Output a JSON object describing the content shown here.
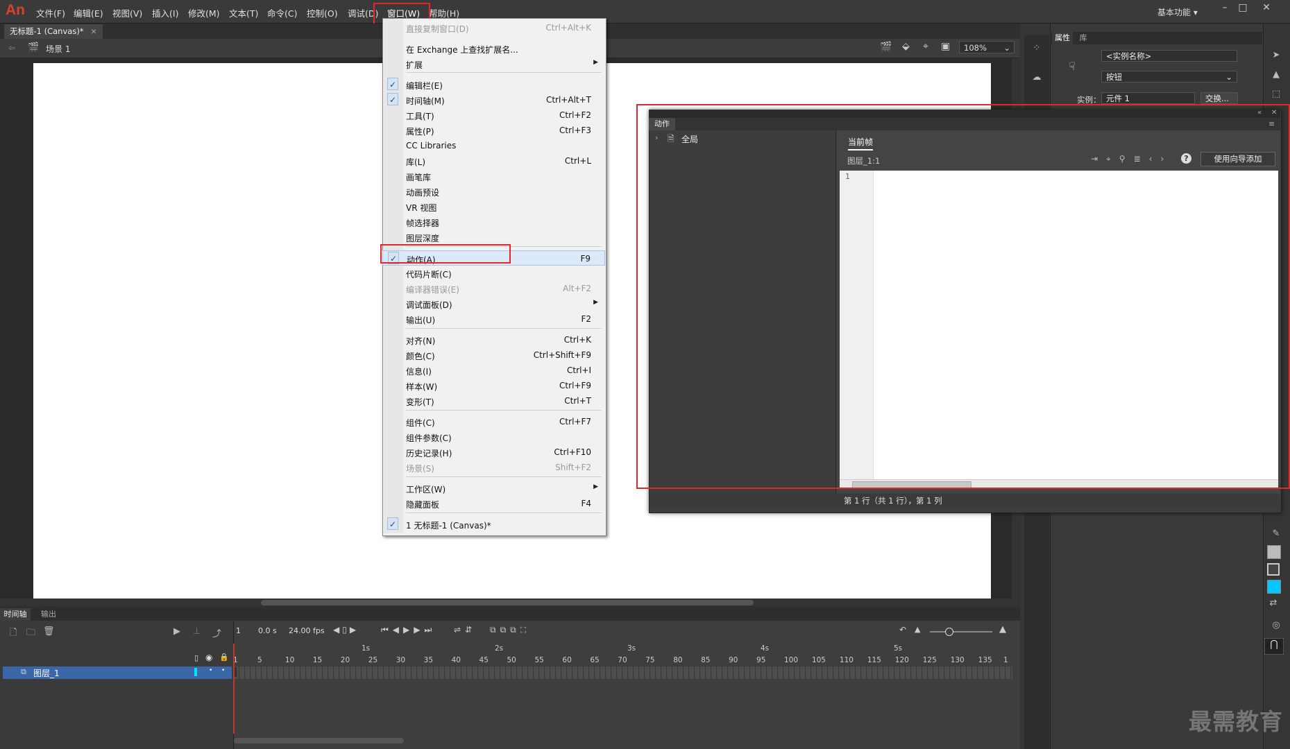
{
  "app": {
    "logo": "An",
    "workspace": "基本功能"
  },
  "menubar": {
    "items": [
      "文件(F)",
      "编辑(E)",
      "视图(V)",
      "插入(I)",
      "修改(M)",
      "文本(T)",
      "命令(C)",
      "控制(O)",
      "调试(D)",
      "窗口(W)",
      "帮助(H)"
    ]
  },
  "document": {
    "tab_title": "无标题-1 (Canvas)*",
    "scene": "场景 1",
    "zoom": "108%"
  },
  "window_menu": {
    "items": [
      {
        "label": "直接复制窗口(D)",
        "shortcut": "Ctrl+Alt+K",
        "disabled": true
      },
      {
        "label": "在 Exchange 上查找扩展名...",
        "shortcut": ""
      },
      {
        "label": "扩展",
        "shortcut": "",
        "submenu": true
      },
      {
        "label": "编辑栏(E)",
        "shortcut": "",
        "checked": true
      },
      {
        "label": "时间轴(M)",
        "shortcut": "Ctrl+Alt+T",
        "checked": true
      },
      {
        "label": "工具(T)",
        "shortcut": "Ctrl+F2"
      },
      {
        "label": "属性(P)",
        "shortcut": "Ctrl+F3"
      },
      {
        "label": "CC Libraries",
        "shortcut": ""
      },
      {
        "label": "库(L)",
        "shortcut": "Ctrl+L"
      },
      {
        "label": "画笔库",
        "shortcut": ""
      },
      {
        "label": "动画预设",
        "shortcut": ""
      },
      {
        "label": "VR 视图",
        "shortcut": ""
      },
      {
        "label": "帧选择器",
        "shortcut": ""
      },
      {
        "label": "图层深度",
        "shortcut": ""
      },
      {
        "label": "动作(A)",
        "shortcut": "F9",
        "checked": true
      },
      {
        "label": "代码片断(C)",
        "shortcut": ""
      },
      {
        "label": "编译器错误(E)",
        "shortcut": "Alt+F2",
        "disabled": true
      },
      {
        "label": "调试面板(D)",
        "shortcut": "",
        "submenu": true
      },
      {
        "label": "输出(U)",
        "shortcut": "F2"
      },
      {
        "label": "对齐(N)",
        "shortcut": "Ctrl+K"
      },
      {
        "label": "颜色(C)",
        "shortcut": "Ctrl+Shift+F9"
      },
      {
        "label": "信息(I)",
        "shortcut": "Ctrl+I"
      },
      {
        "label": "样本(W)",
        "shortcut": "Ctrl+F9"
      },
      {
        "label": "变形(T)",
        "shortcut": "Ctrl+T"
      },
      {
        "label": "组件(C)",
        "shortcut": "Ctrl+F7"
      },
      {
        "label": "组件参数(C)",
        "shortcut": ""
      },
      {
        "label": "历史记录(H)",
        "shortcut": "Ctrl+F10"
      },
      {
        "label": "场景(S)",
        "shortcut": "Shift+F2",
        "disabled": true
      },
      {
        "label": "工作区(W)",
        "shortcut": "",
        "submenu": true
      },
      {
        "label": "隐藏面板",
        "shortcut": "F4"
      },
      {
        "label": "1 无标题-1 (Canvas)*",
        "shortcut": "",
        "checked": true
      }
    ]
  },
  "properties_panel": {
    "tabs": [
      "属性",
      "库"
    ],
    "instance_name_placeholder": "<实例名称>",
    "type_value": "按钮",
    "instance_label": "实例：",
    "instance_value": "元件 1",
    "swap_button": "交换..."
  },
  "actions_panel": {
    "title": "动作",
    "tree_root": "全局",
    "current_frame_tab": "当前帧",
    "layer_path": "图层_1:1",
    "wizard_button": "使用向导添加",
    "line_number": "1",
    "status": "第 1 行（共 1 行），第 1 列"
  },
  "timeline": {
    "tabs": [
      "时间轴",
      "输出"
    ],
    "frame": "1",
    "time": "0.0 s",
    "fps": "24.00 fps",
    "layer_name": "图层_1",
    "ruler_seconds": [
      "1s",
      "2s",
      "3s",
      "4s",
      "5s"
    ],
    "ruler_frames": [
      "1",
      "5",
      "10",
      "15",
      "20",
      "25",
      "30",
      "35",
      "40",
      "45",
      "50",
      "55",
      "60",
      "65",
      "70",
      "75",
      "80",
      "85",
      "90",
      "95",
      "100",
      "105",
      "110",
      "115",
      "120",
      "125",
      "130",
      "135",
      "1"
    ]
  },
  "watermark": "最需教育",
  "colors": {
    "highlight_red": "#e2262a",
    "logo": "#d8432a",
    "layer_selected": "#3b66a8",
    "swatch_fill": "#00c8ff"
  }
}
